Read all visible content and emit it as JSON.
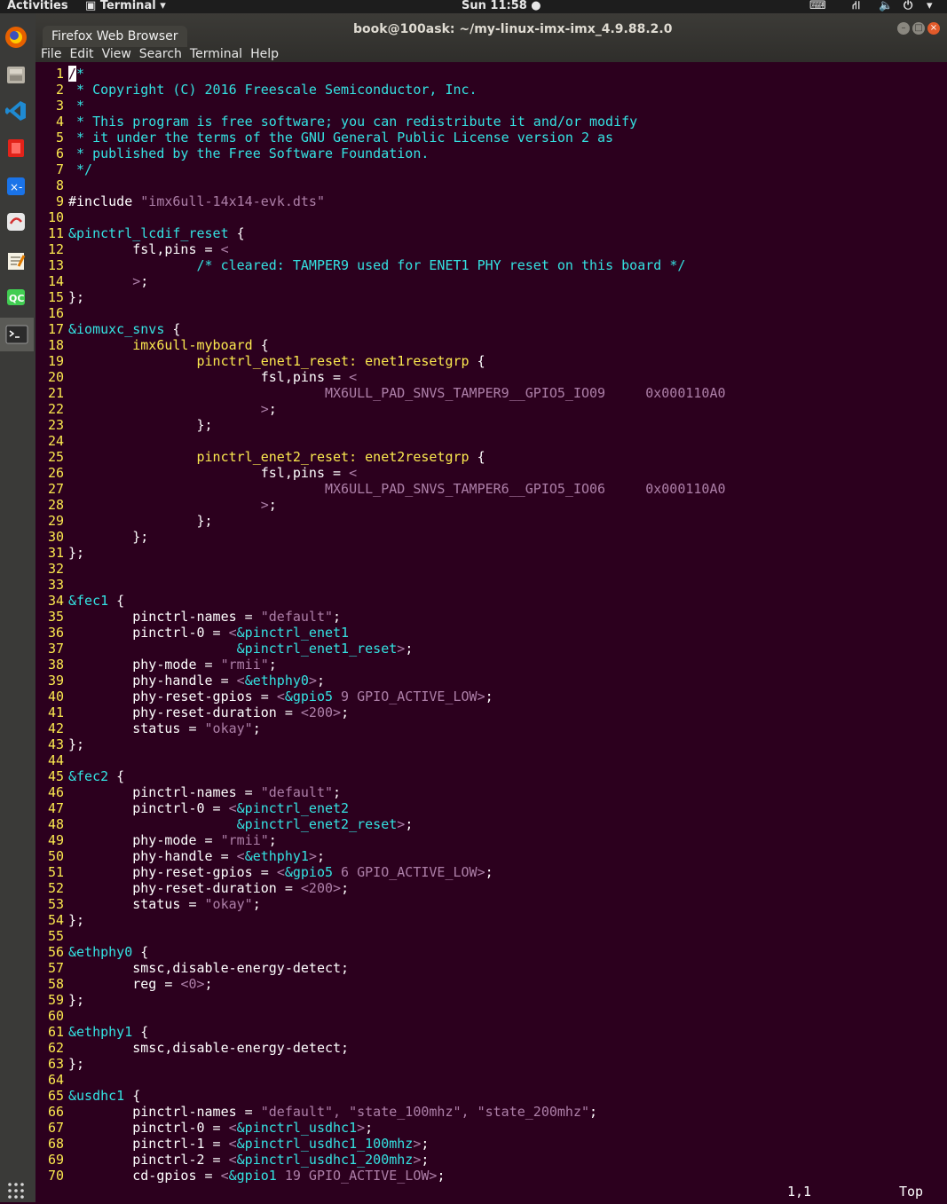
{
  "topbar": {
    "activities": "Activities",
    "app_menu": "Terminal ▾",
    "clock": "Sun 11:58 ●",
    "tray": "▾"
  },
  "dock": {
    "items": [
      "firefox",
      "files",
      "vscode",
      "app-red",
      "app-blue",
      "app-wps",
      "text-editor",
      "qc",
      "terminal",
      "show-apps"
    ]
  },
  "window": {
    "tab_title": "Firefox Web Browser",
    "title": "book@100ask: ~/my-linux-imx-imx_4.9.88.2.0",
    "menu": [
      "File",
      "Edit",
      "View",
      "Search",
      "Terminal",
      "Help"
    ]
  },
  "editor": {
    "lines": [
      [
        [
          "c",
          "/*"
        ]
      ],
      [
        [
          "c",
          " * Copyright (C) 2016 Freescale Semiconductor, Inc."
        ]
      ],
      [
        [
          "c",
          " *"
        ]
      ],
      [
        [
          "c",
          " * This program is free software; you can redistribute it and/or modify"
        ]
      ],
      [
        [
          "c",
          " * it under the terms of the GNU General Public License version 2 as"
        ]
      ],
      [
        [
          "c",
          " * published by the Free Software Foundation."
        ]
      ],
      [
        [
          "c",
          " */"
        ]
      ],
      [
        [
          "p",
          ""
        ]
      ],
      [
        [
          "p",
          "#include "
        ],
        [
          "s",
          "\"imx6ull-14x14-evk.dts\""
        ]
      ],
      [
        [
          "p",
          ""
        ]
      ],
      [
        [
          "r",
          "&pinctrl_lcdif_reset"
        ],
        [
          "p",
          " {"
        ]
      ],
      [
        [
          "p",
          "        fsl,pins = "
        ],
        [
          "s",
          "<"
        ]
      ],
      [
        [
          "p",
          "                "
        ],
        [
          "c",
          "/* cleared: TAMPER9 used for ENET1 PHY reset on this board */"
        ]
      ],
      [
        [
          "p",
          "        "
        ],
        [
          "s",
          ">"
        ],
        [
          "p",
          ";"
        ]
      ],
      [
        [
          "p",
          "};"
        ]
      ],
      [
        [
          "p",
          ""
        ]
      ],
      [
        [
          "r",
          "&iomuxc_snvs"
        ],
        [
          "p",
          " {"
        ]
      ],
      [
        [
          "p",
          "        "
        ],
        [
          "k",
          "imx6ull-myboard"
        ],
        [
          "p",
          " {"
        ]
      ],
      [
        [
          "p",
          "                "
        ],
        [
          "k",
          "pinctrl_enet1_reset:"
        ],
        [
          "p",
          " "
        ],
        [
          "k",
          "enet1resetgrp"
        ],
        [
          "p",
          " {"
        ]
      ],
      [
        [
          "p",
          "                        fsl,pins = "
        ],
        [
          "s",
          "<"
        ]
      ],
      [
        [
          "p",
          "                                "
        ],
        [
          "s",
          "MX6ULL_PAD_SNVS_TAMPER9__GPIO5_IO09     0x000110A0"
        ]
      ],
      [
        [
          "p",
          "                        "
        ],
        [
          "s",
          ">"
        ],
        [
          "p",
          ";"
        ]
      ],
      [
        [
          "p",
          "                };"
        ]
      ],
      [
        [
          "p",
          ""
        ]
      ],
      [
        [
          "p",
          "                "
        ],
        [
          "k",
          "pinctrl_enet2_reset:"
        ],
        [
          "p",
          " "
        ],
        [
          "k",
          "enet2resetgrp"
        ],
        [
          "p",
          " {"
        ]
      ],
      [
        [
          "p",
          "                        fsl,pins = "
        ],
        [
          "s",
          "<"
        ]
      ],
      [
        [
          "p",
          "                                "
        ],
        [
          "s",
          "MX6ULL_PAD_SNVS_TAMPER6__GPIO5_IO06     0x000110A0"
        ]
      ],
      [
        [
          "p",
          "                        "
        ],
        [
          "s",
          ">"
        ],
        [
          "p",
          ";"
        ]
      ],
      [
        [
          "p",
          "                };"
        ]
      ],
      [
        [
          "p",
          "        };"
        ]
      ],
      [
        [
          "p",
          "};"
        ]
      ],
      [
        [
          "p",
          ""
        ]
      ],
      [
        [
          "p",
          ""
        ]
      ],
      [
        [
          "r",
          "&fec1"
        ],
        [
          "p",
          " {"
        ]
      ],
      [
        [
          "p",
          "        pinctrl-names = "
        ],
        [
          "s",
          "\"default\""
        ],
        [
          "p",
          ";"
        ]
      ],
      [
        [
          "p",
          "        pinctrl-0 = "
        ],
        [
          "s",
          "<"
        ],
        [
          "r",
          "&pinctrl_enet1"
        ]
      ],
      [
        [
          "p",
          "                     "
        ],
        [
          "r",
          "&pinctrl_enet1_reset"
        ],
        [
          "s",
          ">"
        ],
        [
          "p",
          ";"
        ]
      ],
      [
        [
          "p",
          "        phy-mode = "
        ],
        [
          "s",
          "\"rmii\""
        ],
        [
          "p",
          ";"
        ]
      ],
      [
        [
          "p",
          "        phy-handle = "
        ],
        [
          "s",
          "<"
        ],
        [
          "r",
          "&ethphy0"
        ],
        [
          "s",
          ">"
        ],
        [
          "p",
          ";"
        ]
      ],
      [
        [
          "p",
          "        phy-reset-gpios = "
        ],
        [
          "s",
          "<"
        ],
        [
          "r",
          "&gpio5"
        ],
        [
          "s",
          " 9 GPIO_ACTIVE_LOW>"
        ],
        [
          "p",
          ";"
        ]
      ],
      [
        [
          "p",
          "        phy-reset-duration = "
        ],
        [
          "s",
          "<200>"
        ],
        [
          "p",
          ";"
        ]
      ],
      [
        [
          "p",
          "        status = "
        ],
        [
          "s",
          "\"okay\""
        ],
        [
          "p",
          ";"
        ]
      ],
      [
        [
          "p",
          "};"
        ]
      ],
      [
        [
          "p",
          ""
        ]
      ],
      [
        [
          "r",
          "&fec2"
        ],
        [
          "p",
          " {"
        ]
      ],
      [
        [
          "p",
          "        pinctrl-names = "
        ],
        [
          "s",
          "\"default\""
        ],
        [
          "p",
          ";"
        ]
      ],
      [
        [
          "p",
          "        pinctrl-0 = "
        ],
        [
          "s",
          "<"
        ],
        [
          "r",
          "&pinctrl_enet2"
        ]
      ],
      [
        [
          "p",
          "                     "
        ],
        [
          "r",
          "&pinctrl_enet2_reset"
        ],
        [
          "s",
          ">"
        ],
        [
          "p",
          ";"
        ]
      ],
      [
        [
          "p",
          "        phy-mode = "
        ],
        [
          "s",
          "\"rmii\""
        ],
        [
          "p",
          ";"
        ]
      ],
      [
        [
          "p",
          "        phy-handle = "
        ],
        [
          "s",
          "<"
        ],
        [
          "r",
          "&ethphy1"
        ],
        [
          "s",
          ">"
        ],
        [
          "p",
          ";"
        ]
      ],
      [
        [
          "p",
          "        phy-reset-gpios = "
        ],
        [
          "s",
          "<"
        ],
        [
          "r",
          "&gpio5"
        ],
        [
          "s",
          " 6 GPIO_ACTIVE_LOW>"
        ],
        [
          "p",
          ";"
        ]
      ],
      [
        [
          "p",
          "        phy-reset-duration = "
        ],
        [
          "s",
          "<200>"
        ],
        [
          "p",
          ";"
        ]
      ],
      [
        [
          "p",
          "        status = "
        ],
        [
          "s",
          "\"okay\""
        ],
        [
          "p",
          ";"
        ]
      ],
      [
        [
          "p",
          "};"
        ]
      ],
      [
        [
          "p",
          ""
        ]
      ],
      [
        [
          "r",
          "&ethphy0"
        ],
        [
          "p",
          " {"
        ]
      ],
      [
        [
          "p",
          "        smsc,disable-energy-detect;"
        ]
      ],
      [
        [
          "p",
          "        reg = "
        ],
        [
          "s",
          "<0>"
        ],
        [
          "p",
          ";"
        ]
      ],
      [
        [
          "p",
          "};"
        ]
      ],
      [
        [
          "p",
          ""
        ]
      ],
      [
        [
          "r",
          "&ethphy1"
        ],
        [
          "p",
          " {"
        ]
      ],
      [
        [
          "p",
          "        smsc,disable-energy-detect;"
        ]
      ],
      [
        [
          "p",
          "};"
        ]
      ],
      [
        [
          "p",
          ""
        ]
      ],
      [
        [
          "r",
          "&usdhc1"
        ],
        [
          "p",
          " {"
        ]
      ],
      [
        [
          "p",
          "        pinctrl-names = "
        ],
        [
          "s",
          "\"default\", \"state_100mhz\", \"state_200mhz\""
        ],
        [
          "p",
          ";"
        ]
      ],
      [
        [
          "p",
          "        pinctrl-0 = "
        ],
        [
          "s",
          "<"
        ],
        [
          "r",
          "&pinctrl_usdhc1"
        ],
        [
          "s",
          ">"
        ],
        [
          "p",
          ";"
        ]
      ],
      [
        [
          "p",
          "        pinctrl-1 = "
        ],
        [
          "s",
          "<"
        ],
        [
          "r",
          "&pinctrl_usdhc1_100mhz"
        ],
        [
          "s",
          ">"
        ],
        [
          "p",
          ";"
        ]
      ],
      [
        [
          "p",
          "        pinctrl-2 = "
        ],
        [
          "s",
          "<"
        ],
        [
          "r",
          "&pinctrl_usdhc1_200mhz"
        ],
        [
          "s",
          ">"
        ],
        [
          "p",
          ";"
        ]
      ],
      [
        [
          "p",
          "        cd-gpios = "
        ],
        [
          "s",
          "<"
        ],
        [
          "r",
          "&gpio1"
        ],
        [
          "s",
          " 19 GPIO_ACTIVE_LOW>"
        ],
        [
          "p",
          ";"
        ]
      ]
    ]
  },
  "status": {
    "position": "1,1",
    "scroll": "Top"
  }
}
